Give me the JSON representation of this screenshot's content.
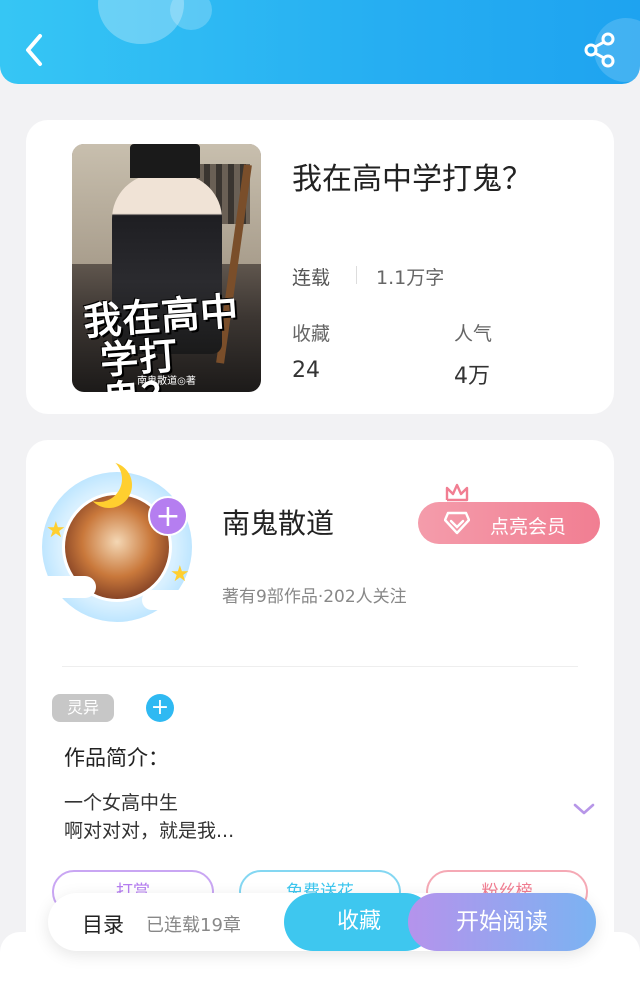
{
  "book": {
    "title": "我在高中学打鬼？",
    "status": "连载",
    "word_count": "1.1万字",
    "stats": [
      {
        "label": "收藏",
        "value": "24"
      },
      {
        "label": "人气",
        "value": "4万"
      }
    ],
    "cover": {
      "title_line1": "我在高中",
      "title_line2": "学打鬼？",
      "author": "南鬼散道◎著"
    }
  },
  "author": {
    "name": "南鬼散道",
    "meta": "著有9部作品·202人关注",
    "vip_label": "点亮会员"
  },
  "tags": [
    "灵异"
  ],
  "intro": {
    "title": "作品简介：",
    "lines": [
      "一个女高中生",
      "啊对对对，就是我..."
    ]
  },
  "action_pills": [
    "打赏",
    "免费送花",
    "粉丝榜"
  ],
  "bottom": {
    "toc_label": "目录",
    "toc_count": "已连载19章",
    "favorite_label": "收藏",
    "read_label": "开始阅读"
  },
  "colors": {
    "accent": "#2fb9f2",
    "vip": "#f17e92",
    "tag": "#c7c7c7",
    "pill_purple": "#b57ef0",
    "pill_blue": "#3ec7ef",
    "pill_pink": "#f17e92"
  },
  "icons": [
    "back-icon",
    "share-icon",
    "crown-icon",
    "diamond-icon",
    "plus-icon",
    "chevron-down-icon"
  ]
}
